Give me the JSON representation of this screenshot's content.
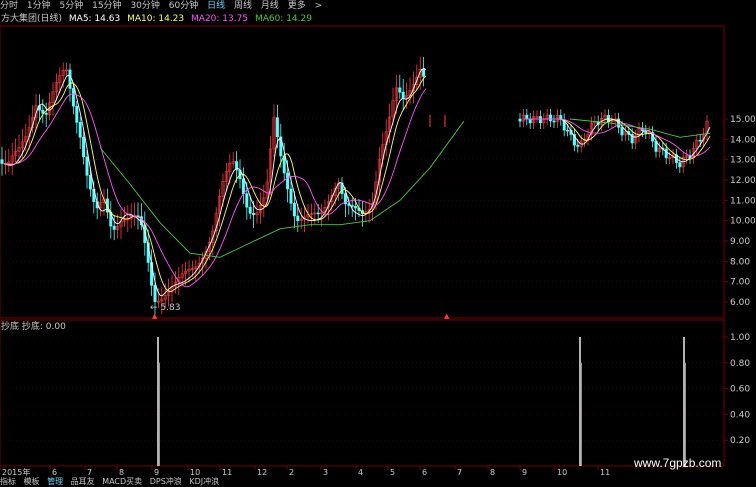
{
  "toolbar": {
    "items": [
      "分时",
      "1分钟",
      "5分钟",
      "15分钟",
      "30分钟",
      "60分钟",
      "日线",
      "周线",
      "月线",
      "更多"
    ],
    "arrow": ">"
  },
  "legend": {
    "name": "方大集团(日线)",
    "ma5": "MA5: 14.63",
    "ma10": "MA10: 14.23",
    "ma20": "MA20: 13.75",
    "ma60": "MA60: 14.29"
  },
  "colors": {
    "ma5": "#ffffff",
    "ma10": "#ffff66",
    "ma20": "#ff55ff",
    "ma60": "#44cc44",
    "up": "#ff3b3b",
    "down": "#55ffff",
    "grid": "#5a0000",
    "axis": "#7a0000"
  },
  "price_axis": {
    "ticks": [
      "15.00",
      "14.00",
      "13.00",
      "12.00",
      "11.00",
      "10.00",
      "9.00",
      "8.00",
      "7.00",
      "6.00"
    ]
  },
  "low_marker": "← 5.83",
  "indicator": {
    "legend": "抄底 抄底: 0.00",
    "ticks": [
      "1.00",
      "0.80",
      "0.60",
      "0.40",
      "0.20"
    ]
  },
  "x_axis": {
    "labels": [
      "2015年",
      "6",
      "7",
      "8",
      "9",
      "10",
      "11",
      "12",
      "2",
      "3",
      "4",
      "5",
      "6",
      "7",
      "8",
      "9",
      "10",
      "11"
    ]
  },
  "bottom_bar": {
    "items": [
      "指标",
      "模板",
      "管理",
      "品耳友",
      "MACD买卖",
      "DPS冲浪",
      "KDJ冲浪"
    ]
  },
  "watermark": "www.7gpzb.com"
}
